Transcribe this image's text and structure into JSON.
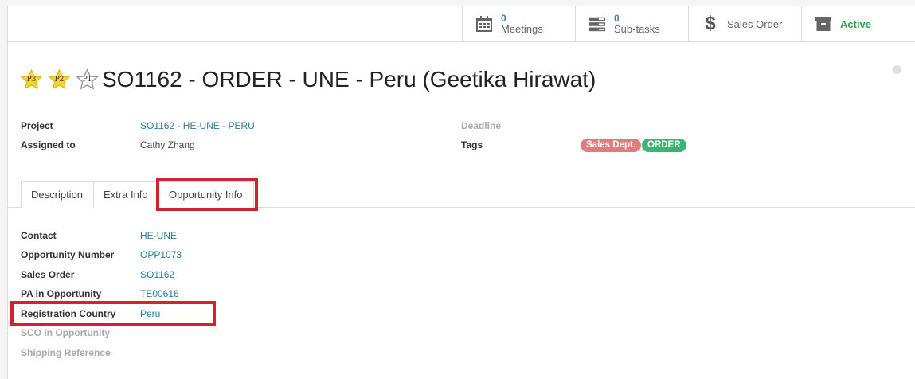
{
  "stat_buttons": {
    "meetings": {
      "count": "0",
      "label": "Meetings"
    },
    "subtasks": {
      "count": "0",
      "label": "Sub-tasks"
    },
    "sales_order": {
      "label": "Sales Order"
    },
    "active": {
      "label": "Active"
    }
  },
  "priority": [
    "P3",
    "P2",
    "P1"
  ],
  "title": "SO1162 - ORDER - UNE - Peru (Geetika Hirawat)",
  "fields": {
    "project_label": "Project",
    "project_value": "SO1162 - HE-UNE - PERU",
    "assigned_label": "Assigned to",
    "assigned_value": "Cathy Zhang",
    "deadline_label": "Deadline",
    "tags_label": "Tags"
  },
  "tags": [
    {
      "label": "Sales Dept.",
      "color": "#e07c7c"
    },
    {
      "label": "ORDER",
      "color": "#3cb371"
    }
  ],
  "tabs": [
    "Description",
    "Extra Info",
    "Opportunity Info"
  ],
  "opportunity": {
    "contact_label": "Contact",
    "contact_value": "HE-UNE",
    "opp_number_label": "Opportunity Number",
    "opp_number_value": "OPP1073",
    "sales_order_label": "Sales Order",
    "sales_order_value": "SO1162",
    "pa_label": "PA in Opportunity",
    "pa_value": "TE00616",
    "reg_country_label": "Registration Country",
    "reg_country_value": "Peru",
    "sco_label": "SCO in Opportunity",
    "shipping_label": "Shipping Reference"
  },
  "colors": {
    "link": "#2a7aa0",
    "highlight": "#d0232e",
    "active": "#2ba24c"
  }
}
